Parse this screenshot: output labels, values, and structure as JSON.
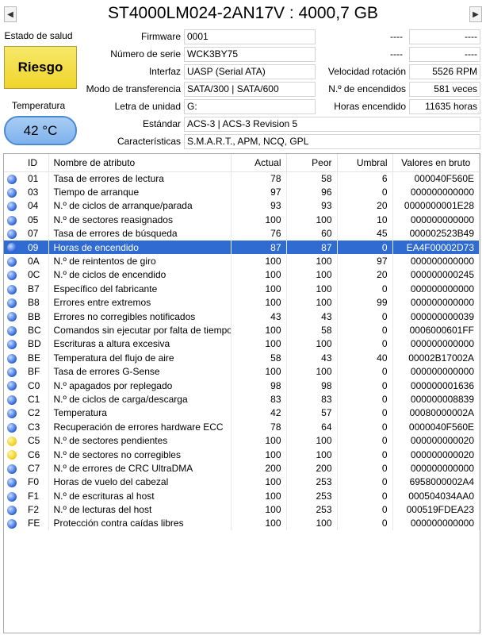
{
  "header": {
    "prev": "◀",
    "next": "▶",
    "title": "ST4000LM024-2AN17V : 4000,7 GB"
  },
  "health": {
    "label": "Estado de salud",
    "value": "Riesgo",
    "color": "#efd52a"
  },
  "temperature": {
    "label": "Temperatura",
    "value": "42 °C",
    "color": "#7fb2ec"
  },
  "info": {
    "firmware": {
      "label": "Firmware",
      "value": "0001"
    },
    "serial": {
      "label": "Número de serie",
      "value": "WCK3BY75"
    },
    "interface": {
      "label": "Interfaz",
      "value": "UASP (Serial ATA)"
    },
    "transfer": {
      "label": "Modo de transferencia",
      "value": "SATA/300 | SATA/600"
    },
    "drive_letter": {
      "label": "Letra de unidad",
      "value": "G:"
    },
    "standard": {
      "label": "Estándar",
      "value": "ACS-3 | ACS-3 Revision 5"
    },
    "features": {
      "label": "Características",
      "value": "S.M.A.R.T., APM, NCQ, GPL"
    },
    "blank1_a": "----",
    "blank1_b": "----",
    "blank2_a": "----",
    "blank2_b": "----",
    "rotation": {
      "label": "Velocidad rotación",
      "value": "5526 RPM"
    },
    "power_count": {
      "label": "N.º de encendidos",
      "value": "581 veces"
    },
    "power_hours": {
      "label": "Horas encendido",
      "value": "11635 horas"
    }
  },
  "table": {
    "headers": [
      "ID",
      "Nombre de atributo",
      "Actual",
      "Peor",
      "Umbral",
      "Valores en bruto"
    ],
    "selected_index": 5,
    "rows": [
      {
        "status": "blue",
        "id": "01",
        "name": "Tasa de errores de lectura",
        "cur": "78",
        "worst": "58",
        "thr": "6",
        "raw": "000040F560E"
      },
      {
        "status": "blue",
        "id": "03",
        "name": "Tiempo de arranque",
        "cur": "97",
        "worst": "96",
        "thr": "0",
        "raw": "000000000000"
      },
      {
        "status": "blue",
        "id": "04",
        "name": "N.º de ciclos de arranque/parada",
        "cur": "93",
        "worst": "93",
        "thr": "20",
        "raw": "0000000001E28"
      },
      {
        "status": "blue",
        "id": "05",
        "name": "N.º de sectores reasignados",
        "cur": "100",
        "worst": "100",
        "thr": "10",
        "raw": "000000000000"
      },
      {
        "status": "blue",
        "id": "07",
        "name": "Tasa de errores de búsqueda",
        "cur": "76",
        "worst": "60",
        "thr": "45",
        "raw": "000002523B49"
      },
      {
        "status": "blue",
        "id": "09",
        "name": "Horas de encendido",
        "cur": "87",
        "worst": "87",
        "thr": "0",
        "raw": "EA4F00002D73"
      },
      {
        "status": "blue",
        "id": "0A",
        "name": "N.º de reintentos de giro",
        "cur": "100",
        "worst": "100",
        "thr": "97",
        "raw": "000000000000"
      },
      {
        "status": "blue",
        "id": "0C",
        "name": "N.º de ciclos de encendido",
        "cur": "100",
        "worst": "100",
        "thr": "20",
        "raw": "000000000245"
      },
      {
        "status": "blue",
        "id": "B7",
        "name": "Específico del fabricante",
        "cur": "100",
        "worst": "100",
        "thr": "0",
        "raw": "000000000000"
      },
      {
        "status": "blue",
        "id": "B8",
        "name": "Errores entre extremos",
        "cur": "100",
        "worst": "100",
        "thr": "99",
        "raw": "000000000000"
      },
      {
        "status": "blue",
        "id": "BB",
        "name": "Errores no corregibles notificados",
        "cur": "43",
        "worst": "43",
        "thr": "0",
        "raw": "000000000039"
      },
      {
        "status": "blue",
        "id": "BC",
        "name": "Comandos sin ejecutar por falta de tiempo",
        "cur": "100",
        "worst": "58",
        "thr": "0",
        "raw": "0006000601FF"
      },
      {
        "status": "blue",
        "id": "BD",
        "name": "Escrituras a altura excesiva",
        "cur": "100",
        "worst": "100",
        "thr": "0",
        "raw": "000000000000"
      },
      {
        "status": "blue",
        "id": "BE",
        "name": "Temperatura del flujo de aire",
        "cur": "58",
        "worst": "43",
        "thr": "40",
        "raw": "00002B17002A"
      },
      {
        "status": "blue",
        "id": "BF",
        "name": "Tasa de errores G-Sense",
        "cur": "100",
        "worst": "100",
        "thr": "0",
        "raw": "000000000000"
      },
      {
        "status": "blue",
        "id": "C0",
        "name": "N.º apagados por replegado",
        "cur": "98",
        "worst": "98",
        "thr": "0",
        "raw": "000000001636"
      },
      {
        "status": "blue",
        "id": "C1",
        "name": "N.º de ciclos de carga/descarga",
        "cur": "83",
        "worst": "83",
        "thr": "0",
        "raw": "000000008839"
      },
      {
        "status": "blue",
        "id": "C2",
        "name": "Temperatura",
        "cur": "42",
        "worst": "57",
        "thr": "0",
        "raw": "00080000002A"
      },
      {
        "status": "blue",
        "id": "C3",
        "name": "Recuperación de errores hardware ECC",
        "cur": "78",
        "worst": "64",
        "thr": "0",
        "raw": "0000040F560E"
      },
      {
        "status": "yellow",
        "id": "C5",
        "name": "N.º de sectores pendientes",
        "cur": "100",
        "worst": "100",
        "thr": "0",
        "raw": "000000000020"
      },
      {
        "status": "yellow",
        "id": "C6",
        "name": "N.º de sectores no corregibles",
        "cur": "100",
        "worst": "100",
        "thr": "0",
        "raw": "000000000020"
      },
      {
        "status": "blue",
        "id": "C7",
        "name": "N.º de errores de CRC UltraDMA",
        "cur": "200",
        "worst": "200",
        "thr": "0",
        "raw": "000000000000"
      },
      {
        "status": "blue",
        "id": "F0",
        "name": "Horas de vuelo del cabezal",
        "cur": "100",
        "worst": "253",
        "thr": "0",
        "raw": "6958000002A4"
      },
      {
        "status": "blue",
        "id": "F1",
        "name": "N.º de escrituras al host",
        "cur": "100",
        "worst": "253",
        "thr": "0",
        "raw": "000504034AA0"
      },
      {
        "status": "blue",
        "id": "F2",
        "name": "N.º de lecturas del host",
        "cur": "100",
        "worst": "253",
        "thr": "0",
        "raw": "000519FDEA23"
      },
      {
        "status": "blue",
        "id": "FE",
        "name": "Protección contra caídas libres",
        "cur": "100",
        "worst": "100",
        "thr": "0",
        "raw": "000000000000"
      }
    ]
  }
}
